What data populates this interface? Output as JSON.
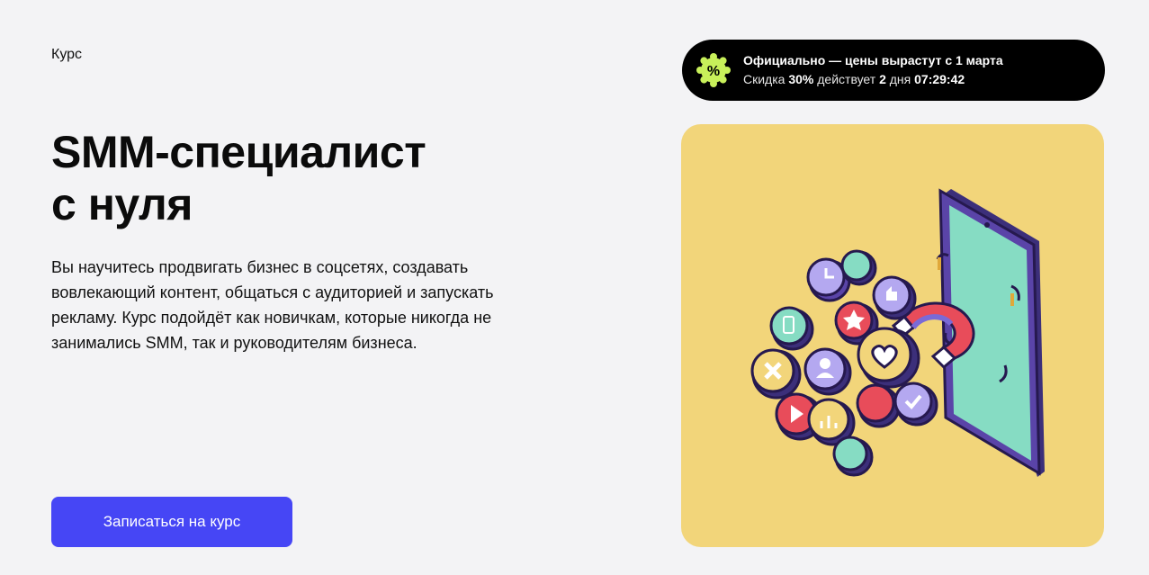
{
  "eyebrow": "Курс",
  "title": {
    "line1": "SMM-специалист",
    "line2": "с нуля"
  },
  "description": "Вы научитесь продвигать бизнес в соцсетях, создавать вовлекающий контент, общаться с аудиторией и запускать рекламу. Курс подойдёт как новичкам, которые никогда не занимались SMM, так и руководителям бизнеса.",
  "cta_label": "Записаться на курс",
  "promo": {
    "badge_icon": "percent-icon",
    "headline": "Официально — цены вырастут с 1 марта",
    "discount_prefix": "Скидка",
    "discount_value": "30%",
    "discount_mid": "действует",
    "days_value": "2",
    "days_label": "дня",
    "timer": "07:29:42"
  },
  "colors": {
    "accent": "#4646f5",
    "hero_bg": "#f2d57a",
    "promo_bg": "#000000",
    "badge": "#c8f05a"
  }
}
